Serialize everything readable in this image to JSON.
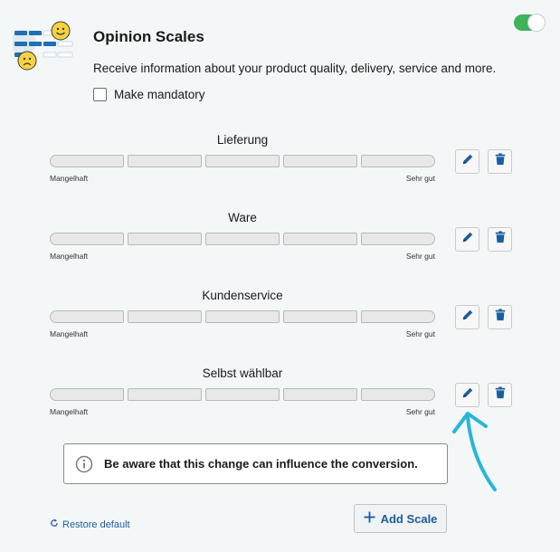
{
  "header": {
    "title": "Opinion Scales",
    "description": "Receive information about your product quality, delivery, service and more.",
    "mandatory_label": "Make mandatory",
    "mandatory_checked": false,
    "toggle_on": true
  },
  "scales": [
    {
      "title": "Lieferung",
      "low_label": "Mangelhaft",
      "high_label": "Sehr gut"
    },
    {
      "title": "Ware",
      "low_label": "Mangelhaft",
      "high_label": "Sehr gut"
    },
    {
      "title": "Kundenservice",
      "low_label": "Mangelhaft",
      "high_label": "Sehr gut"
    },
    {
      "title": "Selbst wählbar",
      "low_label": "Mangelhaft",
      "high_label": "Sehr gut"
    }
  ],
  "icons": {
    "edit": "pencil-icon",
    "delete": "trash-icon",
    "info": "info-icon",
    "restore": "refresh-icon",
    "add": "plus-icon"
  },
  "notice": {
    "text": "Be aware that this change can influence the conversion."
  },
  "footer": {
    "restore_label": "Restore default",
    "add_scale_label": "Add Scale"
  },
  "colors": {
    "accent": "#1b5e9e",
    "toggle_on": "#3db35a",
    "annotation": "#29b6d6"
  }
}
